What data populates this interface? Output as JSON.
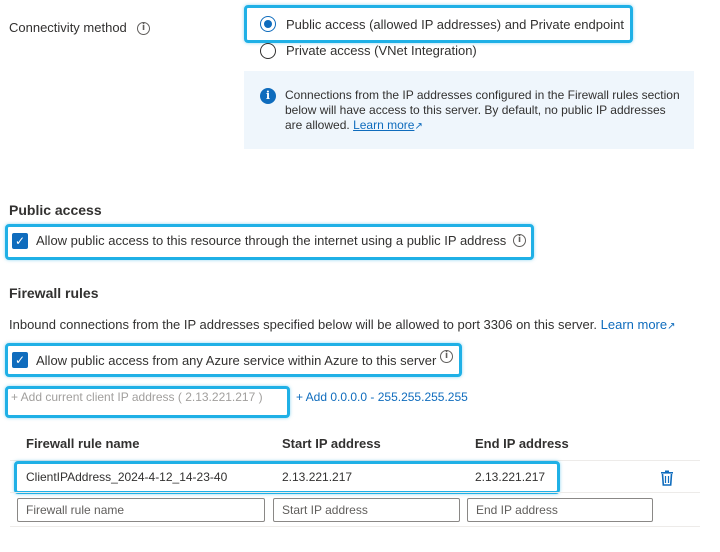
{
  "connectivity": {
    "label": "Connectivity method",
    "options": [
      {
        "label": "Public access (allowed IP addresses) and Private endpoint",
        "selected": true
      },
      {
        "label": "Private access (VNet Integration)",
        "selected": false
      }
    ],
    "info": {
      "text": "Connections from the IP addresses configured in the Firewall rules section below will have access to this server. By default, no public IP addresses are allowed.",
      "link": "Learn more"
    }
  },
  "public_access": {
    "title": "Public access",
    "checkbox_label": "Allow public access to this resource through the internet using a public IP address",
    "checked": true
  },
  "firewall": {
    "title": "Firewall rules",
    "description": "Inbound connections from the IP addresses specified below will be allowed to port 3306 on this server.",
    "learn_more": "Learn more",
    "azure_checkbox_label": "Allow public access from any Azure service within Azure to this server",
    "azure_checked": true,
    "add_client_ip": "+ Add current client IP address ( 2.13.221.217 )",
    "add_range": "+ Add 0.0.0.0 - 255.255.255.255",
    "columns": [
      "Firewall rule name",
      "Start IP address",
      "End IP address"
    ],
    "rows": [
      {
        "name": "ClientIPAddress_2024-4-12_14-23-40",
        "start": "2.13.221.217",
        "end": "2.13.221.217"
      }
    ],
    "new_row_placeholders": {
      "name": "Firewall rule name",
      "start": "Start IP address",
      "end": "End IP address"
    }
  },
  "colors": {
    "accent": "#0f6cbd",
    "highlight": "#1fb0e6",
    "infobox_bg": "#eff6fc"
  },
  "icons": {
    "info": "info-icon",
    "delete": "trash-icon",
    "external": "external-link-icon",
    "check": "checkmark-icon"
  }
}
